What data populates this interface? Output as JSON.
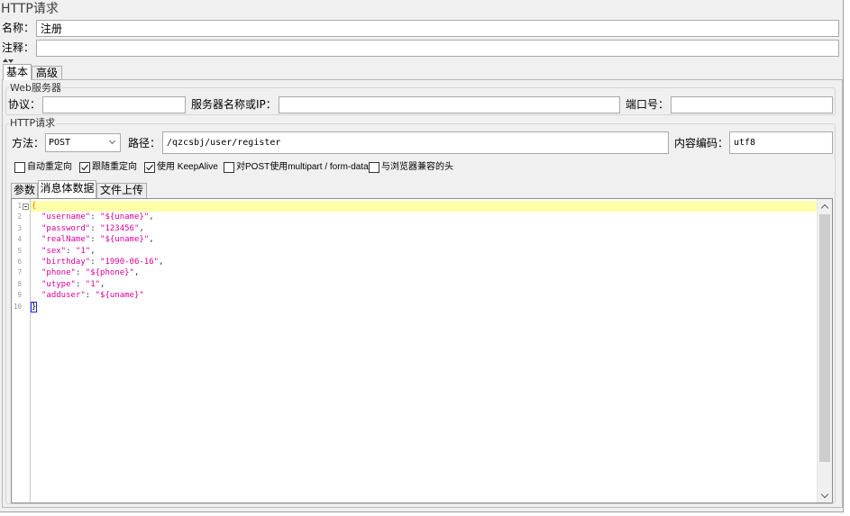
{
  "window": {
    "title": "HTTP请求"
  },
  "name_field": {
    "label": "名称：",
    "value": "注册"
  },
  "comment_field": {
    "label": "注释：",
    "value": ""
  },
  "main_tabs": [
    {
      "label": "基本",
      "selected": true
    },
    {
      "label": "高级",
      "selected": false
    }
  ],
  "web_server": {
    "legend": "Web服务器",
    "protocol": {
      "label": "协议：",
      "value": ""
    },
    "server": {
      "label": "服务器名称或IP：",
      "value": ""
    },
    "port": {
      "label": "端口号：",
      "value": ""
    }
  },
  "http_request": {
    "legend": "HTTP请求",
    "method": {
      "label": "方法：",
      "value": "POST"
    },
    "path": {
      "label": "路径：",
      "value": "/qzcsbj/user/register"
    },
    "encoding": {
      "label": "内容编码：",
      "value": "utf8"
    },
    "options": [
      {
        "label": "自动重定向",
        "checked": false
      },
      {
        "label": "跟随重定向",
        "checked": true
      },
      {
        "label": "使用 KeepAlive",
        "checked": true
      },
      {
        "label": "对POST使用multipart / form-data",
        "checked": false
      },
      {
        "label": "与浏览器兼容的头",
        "checked": false
      }
    ]
  },
  "body_tabs": [
    {
      "label": "参数",
      "selected": false
    },
    {
      "label": "消息体数据",
      "selected": true
    },
    {
      "label": "文件上传",
      "selected": false
    }
  ],
  "editor": {
    "lines": [
      {
        "num": "1",
        "open": "{"
      },
      {
        "num": "2",
        "key": "\"username\"",
        "colon": ": ",
        "value": "\"${uname}\"",
        "comma": ","
      },
      {
        "num": "3",
        "key": "\"password\"",
        "colon": ": ",
        "value": "\"123456\"",
        "comma": ","
      },
      {
        "num": "4",
        "key": "\"realName\"",
        "colon": ": ",
        "value": "\"${uname}\"",
        "comma": ","
      },
      {
        "num": "5",
        "key": "\"sex\"",
        "colon": ": ",
        "value": "\"1\"",
        "comma": ","
      },
      {
        "num": "6",
        "key": "\"birthday\"",
        "colon": ": ",
        "value": "\"1990-06-16\"",
        "comma": ","
      },
      {
        "num": "7",
        "key": "\"phone\"",
        "colon": ": ",
        "value": "\"${phone}\"",
        "comma": ","
      },
      {
        "num": "8",
        "key": "\"utype\"",
        "colon": ": ",
        "value": "\"1\"",
        "comma": ","
      },
      {
        "num": "9",
        "key": "\"adduser\"",
        "colon": ": ",
        "value": "\"${uname}\""
      },
      {
        "num": "10",
        "close": "}"
      }
    ]
  },
  "icons": {
    "split_up": "triangle-up-icon",
    "split_down": "triangle-down-icon",
    "method_dropdown": "chevron-down-icon",
    "checkbox_mark": "checkmark-icon",
    "fold": "fold-collapse-icon",
    "scroll_up": "chevron-up-icon",
    "scroll_down": "chevron-down-icon"
  },
  "colors": {
    "string_literal": "#dc009c",
    "bracket": "#f07800",
    "line_highlight": "#ffffaa",
    "line_number": "#999999",
    "bracket_match": "#2020ff"
  }
}
